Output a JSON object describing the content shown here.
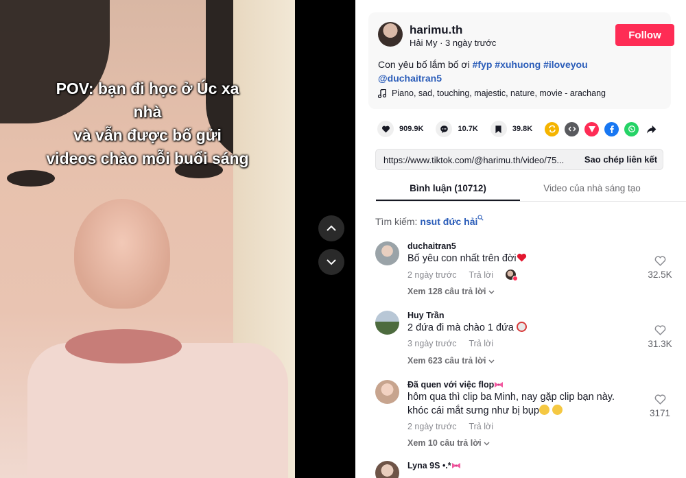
{
  "video": {
    "overlay_text": [
      "POV: bạn đi học ở Úc xa nhà",
      "và vẫn được bố gửi",
      "videos chào mỗi buổi sáng"
    ]
  },
  "author": {
    "handle": "harimu.th",
    "display_name": "Hải My",
    "posted": "3 ngày trước",
    "follow_label": "Follow"
  },
  "caption": {
    "text": "Con yêu bố lắm bố ơi",
    "hashtags": [
      "#fyp",
      "#xuhuong",
      "#iloveyou"
    ],
    "mention": "@duchaitran5"
  },
  "music": {
    "icon": "music-note-icon",
    "title": "Piano, sad, touching, majestic, nature, movie - arachang"
  },
  "stats": {
    "likes": "909.9K",
    "comments": "10.7K",
    "saves": "39.8K"
  },
  "share_targets": [
    {
      "name": "repost-icon",
      "color": "#f5b400"
    },
    {
      "name": "embed-icon",
      "color": "#595a5e"
    },
    {
      "name": "send-icon",
      "color": "#fe2c55"
    },
    {
      "name": "facebook-icon",
      "color": "#1877f2"
    },
    {
      "name": "whatsapp-icon",
      "color": "#25d366"
    },
    {
      "name": "share-arrow-icon",
      "color": "#161823"
    }
  ],
  "link": {
    "url": "https://www.tiktok.com/@harimu.th/video/75...",
    "copy_label": "Sao chép liên kết"
  },
  "tabs": {
    "comments": "Bình luận (10712)",
    "creator_videos": "Video của nhà sáng tạo"
  },
  "search": {
    "label": "Tìm kiếm:",
    "term": "nsut đức hải"
  },
  "comments": [
    {
      "user": "duchaitran5",
      "text": "Bố yêu con nhất trên đời",
      "time": "2 ngày trước",
      "reply": "Trả lời",
      "likes": "32.5K",
      "view_replies": "Xem 128 câu trả lời"
    },
    {
      "user": "Huy Trần",
      "text": "2 đứa đi mà chào 1 đứa",
      "time": "3 ngày trước",
      "reply": "Trả lời",
      "likes": "31.3K",
      "view_replies": "Xem 623 câu trả lời"
    },
    {
      "user": "Đã quen với việc flop",
      "text": "hôm qua thì clip ba Minh, nay gặp clip bạn này. khóc cái mắt sưng như bị bụp",
      "time": "2 ngày trước",
      "reply": "Trả lời",
      "likes": "3171",
      "view_replies": "Xem 10 câu trả lời"
    },
    {
      "user": "Lyna 9S •.*"
    }
  ],
  "colors": {
    "accent": "#fe2c55",
    "link": "#2b5db9"
  }
}
